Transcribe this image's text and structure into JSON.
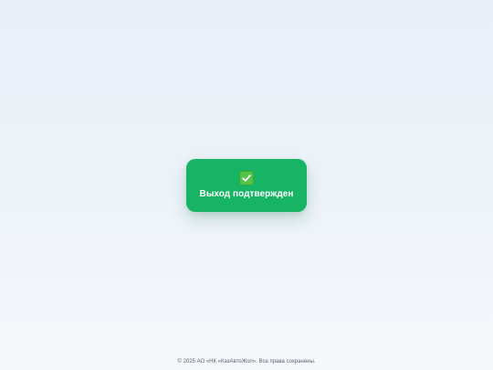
{
  "toast": {
    "icon": "check-mark-icon",
    "message": "Выход подтвержден",
    "color": "#16b464"
  },
  "footer": {
    "copyright": "© 2025 АО «НК «КазАвтоЖол». Все права сохранены."
  }
}
